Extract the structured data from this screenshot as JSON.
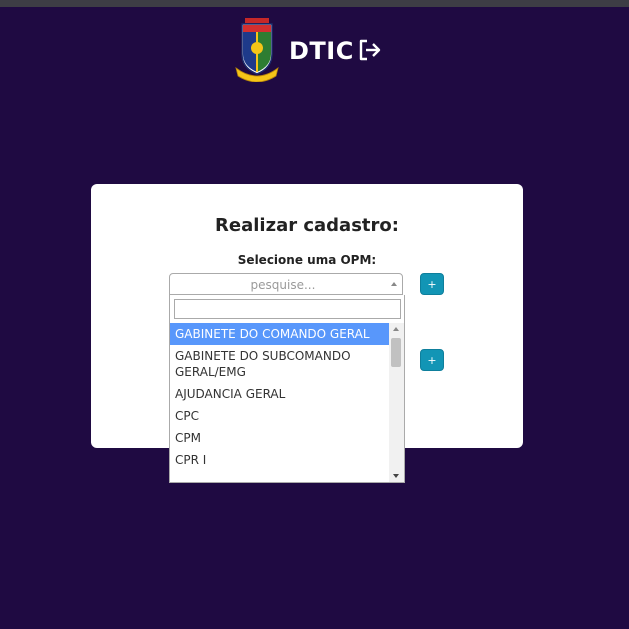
{
  "header": {
    "brand": "DTIC"
  },
  "icons": {
    "logo": "dtic-shield-logo",
    "logout": "logout-icon"
  },
  "form": {
    "title": "Realizar cadastro:",
    "opm_label": "Selecione uma OPM:",
    "opm_placeholder": "pesquise...",
    "add_label": "+"
  },
  "dropdown": {
    "search_value": "",
    "options": [
      "GABINETE DO COMANDO GERAL",
      "GABINETE DO SUBCOMANDO GERAL/EMG",
      "AJUDANCIA GERAL",
      "CPC",
      "CPM",
      "CPR I"
    ],
    "highlighted_index": 0
  },
  "colors": {
    "background": "#1f0a42",
    "accent": "#1295b5",
    "highlight": "#5897fb"
  }
}
